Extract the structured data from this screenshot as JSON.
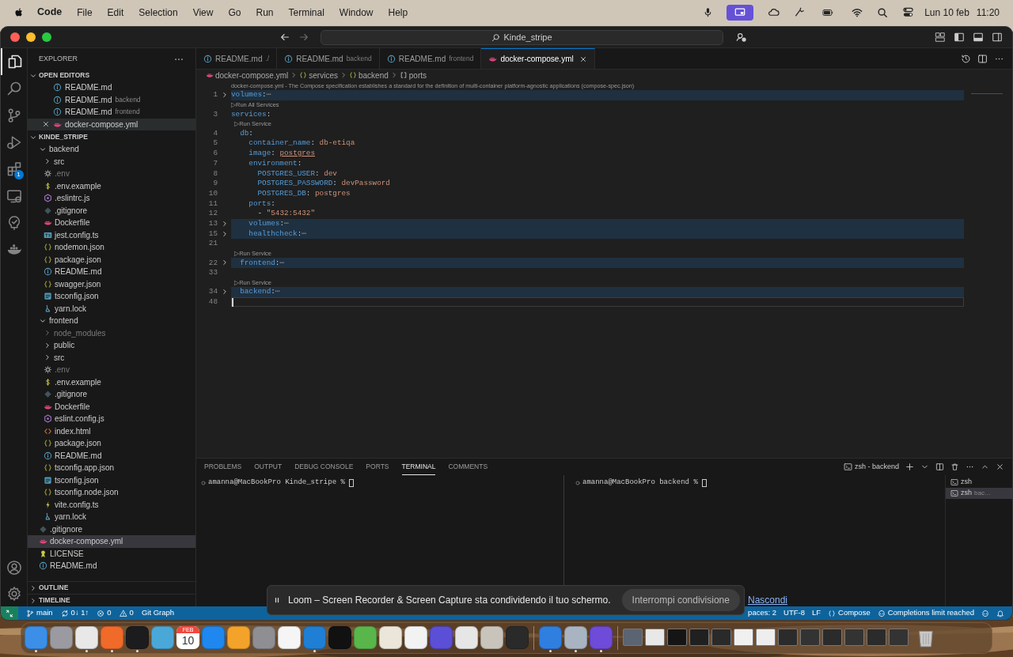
{
  "menu_bar": {
    "app": "Code",
    "menus": [
      "File",
      "Edit",
      "Selection",
      "View",
      "Go",
      "Run",
      "Terminal",
      "Window",
      "Help"
    ],
    "date": "Lun 10 feb",
    "time": "11:20"
  },
  "title_bar": {
    "search": "Kinde_stripe"
  },
  "activity_bar": {
    "items": [
      {
        "selected": true
      },
      {
        "selected": false
      },
      {
        "selected": false
      },
      {
        "selected": false
      },
      {
        "selected": false,
        "badge": "1"
      },
      {
        "selected": false
      },
      {
        "selected": false
      },
      {
        "selected": false
      }
    ]
  },
  "sidebar": {
    "title": "EXPLORER",
    "open_editors": {
      "label": "OPEN EDITORS",
      "expanded": true,
      "items": [
        {
          "name": "README.md",
          "kind": "info",
          "selected": false
        },
        {
          "name": "README.md",
          "hint": "backend",
          "kind": "info",
          "selected": false
        },
        {
          "name": "README.md",
          "hint": "frontend",
          "kind": "info",
          "selected": false
        },
        {
          "name": "docker-compose.yml",
          "kind": "docker",
          "selected": true
        }
      ]
    },
    "project": {
      "label": "KINDE_STRIPE",
      "expanded": true,
      "children": [
        {
          "name": "backend",
          "kind": "folder",
          "expanded": true,
          "dimmed": false,
          "selected": false,
          "children": [
            {
              "name": "src",
              "kind": "folder",
              "expanded": false,
              "dimmed": false,
              "selected": false
            },
            {
              "name": ".env",
              "kind": "gear",
              "dimmed": true,
              "selected": false
            },
            {
              "name": ".env.example",
              "kind": "dollar",
              "dimmed": false,
              "selected": false
            },
            {
              "name": ".eslintrc.js",
              "kind": "eslint",
              "dimmed": false,
              "selected": false
            },
            {
              "name": ".gitignore",
              "kind": "git",
              "dimmed": false,
              "selected": false
            },
            {
              "name": "Dockerfile",
              "kind": "docker",
              "dimmed": false,
              "selected": false
            },
            {
              "name": "jest.config.ts",
              "kind": "ts",
              "dimmed": false,
              "selected": false
            },
            {
              "name": "nodemon.json",
              "kind": "braces",
              "dimmed": false,
              "selected": false
            },
            {
              "name": "package.json",
              "kind": "braces",
              "dimmed": false,
              "selected": false
            },
            {
              "name": "README.md",
              "kind": "info",
              "dimmed": false,
              "selected": false
            },
            {
              "name": "swagger.json",
              "kind": "braces",
              "dimmed": false,
              "selected": false
            },
            {
              "name": "tsconfig.json",
              "kind": "tsconfig",
              "dimmed": false,
              "selected": false
            },
            {
              "name": "yarn.lock",
              "kind": "yarn",
              "dimmed": false,
              "selected": false
            }
          ]
        },
        {
          "name": "frontend",
          "kind": "folder",
          "expanded": true,
          "dimmed": false,
          "selected": false,
          "children": [
            {
              "name": "node_modules",
              "kind": "folder",
              "expanded": false,
              "dimmed": true,
              "selected": false
            },
            {
              "name": "public",
              "kind": "folder",
              "expanded": false,
              "dimmed": false,
              "selected": false
            },
            {
              "name": "src",
              "kind": "folder",
              "expanded": false,
              "dimmed": false,
              "selected": false
            },
            {
              "name": ".env",
              "kind": "gear",
              "dimmed": true,
              "selected": false
            },
            {
              "name": ".env.example",
              "kind": "dollar",
              "dimmed": false,
              "selected": false
            },
            {
              "name": ".gitignore",
              "kind": "git",
              "dimmed": false,
              "selected": false
            },
            {
              "name": "Dockerfile",
              "kind": "docker",
              "dimmed": false,
              "selected": false
            },
            {
              "name": "eslint.config.js",
              "kind": "eslint",
              "dimmed": false,
              "selected": false
            },
            {
              "name": "index.html",
              "kind": "html",
              "dimmed": false,
              "selected": false
            },
            {
              "name": "package.json",
              "kind": "braces",
              "dimmed": false,
              "selected": false
            },
            {
              "name": "README.md",
              "kind": "info",
              "dimmed": false,
              "selected": false
            },
            {
              "name": "tsconfig.app.json",
              "kind": "braces",
              "dimmed": false,
              "selected": false
            },
            {
              "name": "tsconfig.json",
              "kind": "tsconfig",
              "dimmed": false,
              "selected": false
            },
            {
              "name": "tsconfig.node.json",
              "kind": "braces",
              "dimmed": false,
              "selected": false
            },
            {
              "name": "vite.config.ts",
              "kind": "vite",
              "dimmed": false,
              "selected": false
            },
            {
              "name": "yarn.lock",
              "kind": "yarn",
              "dimmed": false,
              "selected": false
            }
          ]
        },
        {
          "name": ".gitignore",
          "kind": "git",
          "dimmed": false,
          "selected": false
        },
        {
          "name": "docker-compose.yml",
          "kind": "docker",
          "dimmed": false,
          "selected": true
        },
        {
          "name": "LICENSE",
          "kind": "license",
          "dimmed": false,
          "selected": false
        },
        {
          "name": "README.md",
          "kind": "info",
          "dimmed": false,
          "selected": false
        }
      ]
    },
    "outline": {
      "label": "OUTLINE",
      "expanded": false
    },
    "timeline": {
      "label": "TIMELINE",
      "expanded": false
    }
  },
  "tabs": [
    {
      "label": "README.md",
      "hint": "./",
      "kind": "info",
      "selected": false
    },
    {
      "label": "README.md",
      "hint": "backend",
      "kind": "info",
      "selected": false
    },
    {
      "label": "README.md",
      "hint": "frontend",
      "kind": "info",
      "selected": false
    },
    {
      "label": "docker-compose.yml",
      "kind": "docker",
      "selected": true
    }
  ],
  "breadcrumbs": [
    {
      "kind": "docker",
      "label": "docker-compose.yml"
    },
    {
      "kind": "braces",
      "label": "services"
    },
    {
      "kind": "braces",
      "label": "backend"
    },
    {
      "kind": "brackets",
      "label": "ports"
    }
  ],
  "schema_hint": "docker-compose.yml - The Compose specification establishes a standard for the definition of multi-container platform-agnostic applications (compose-spec.json)",
  "code": [
    {
      "kind": "line",
      "number": "1",
      "folded": true,
      "cursor": false,
      "tokens": [
        {
          "text": "volumes",
          "kind": "key"
        },
        {
          "text": ":",
          "kind": "punct"
        },
        {
          "text": "⋯",
          "kind": "fold"
        }
      ]
    },
    {
      "kind": "codelens",
      "text": "▷Run All Services"
    },
    {
      "kind": "line",
      "number": "3",
      "folded": false,
      "cursor": false,
      "tokens": [
        {
          "text": "services",
          "kind": "key"
        },
        {
          "text": ":",
          "kind": "punct"
        }
      ]
    },
    {
      "kind": "codelens",
      "text": "  ▷Run Service"
    },
    {
      "kind": "line",
      "number": "4",
      "folded": false,
      "cursor": false,
      "tokens": [
        {
          "text": "  db",
          "kind": "key"
        },
        {
          "text": ":",
          "kind": "punct"
        }
      ]
    },
    {
      "kind": "line",
      "number": "5",
      "folded": false,
      "cursor": false,
      "tokens": [
        {
          "text": "    container_name",
          "kind": "key"
        },
        {
          "text": ":",
          "kind": "punct"
        },
        {
          "text": " db-etiqa",
          "kind": "value"
        }
      ]
    },
    {
      "kind": "line",
      "number": "6",
      "folded": false,
      "cursor": false,
      "tokens": [
        {
          "text": "    image",
          "kind": "key"
        },
        {
          "text": ": ",
          "kind": "punct"
        },
        {
          "text": "postgres",
          "kind": "value",
          "underlined": true
        }
      ]
    },
    {
      "kind": "line",
      "number": "7",
      "folded": false,
      "cursor": false,
      "tokens": [
        {
          "text": "    environment",
          "kind": "key"
        },
        {
          "text": ":",
          "kind": "punct"
        }
      ]
    },
    {
      "kind": "line",
      "number": "8",
      "folded": false,
      "cursor": false,
      "tokens": [
        {
          "text": "      POSTGRES_USER",
          "kind": "key"
        },
        {
          "text": ":",
          "kind": "punct"
        },
        {
          "text": " dev",
          "kind": "value"
        }
      ]
    },
    {
      "kind": "line",
      "number": "9",
      "folded": false,
      "cursor": false,
      "tokens": [
        {
          "text": "      POSTGRES_PASSWORD",
          "kind": "key"
        },
        {
          "text": ":",
          "kind": "punct"
        },
        {
          "text": " devPassword",
          "kind": "value"
        }
      ]
    },
    {
      "kind": "line",
      "number": "10",
      "folded": false,
      "cursor": false,
      "tokens": [
        {
          "text": "      POSTGRES_DB",
          "kind": "key"
        },
        {
          "text": ":",
          "kind": "punct"
        },
        {
          "text": " postgres",
          "kind": "value"
        }
      ]
    },
    {
      "kind": "line",
      "number": "11",
      "folded": false,
      "cursor": false,
      "tokens": [
        {
          "text": "    ports",
          "kind": "key"
        },
        {
          "text": ":",
          "kind": "punct"
        }
      ]
    },
    {
      "kind": "line",
      "number": "12",
      "folded": false,
      "cursor": false,
      "tokens": [
        {
          "text": "      - ",
          "kind": "punct"
        },
        {
          "text": "\"5432:5432\"",
          "kind": "value"
        }
      ]
    },
    {
      "kind": "line",
      "number": "13",
      "folded": true,
      "cursor": false,
      "tokens": [
        {
          "text": "    volumes",
          "kind": "key"
        },
        {
          "text": ":",
          "kind": "punct"
        },
        {
          "text": "⋯",
          "kind": "fold"
        }
      ]
    },
    {
      "kind": "line",
      "number": "15",
      "folded": true,
      "cursor": false,
      "tokens": [
        {
          "text": "    healthcheck",
          "kind": "key"
        },
        {
          "text": ":",
          "kind": "punct"
        },
        {
          "text": "⋯",
          "kind": "fold"
        }
      ]
    },
    {
      "kind": "line",
      "number": "21",
      "folded": false,
      "cursor": false
    },
    {
      "kind": "codelens",
      "text": "  ▷Run Service"
    },
    {
      "kind": "line",
      "number": "22",
      "folded": true,
      "cursor": false,
      "tokens": [
        {
          "text": "  frontend",
          "kind": "key"
        },
        {
          "text": ":",
          "kind": "punct"
        },
        {
          "text": "⋯",
          "kind": "fold"
        }
      ]
    },
    {
      "kind": "line",
      "number": "33",
      "folded": false,
      "cursor": false
    },
    {
      "kind": "codelens",
      "text": "  ▷Run Service"
    },
    {
      "kind": "line",
      "number": "34",
      "folded": true,
      "cursor": false,
      "tokens": [
        {
          "text": "  backend",
          "kind": "key"
        },
        {
          "text": ":",
          "kind": "punct"
        },
        {
          "text": "⋯",
          "kind": "fold"
        }
      ]
    },
    {
      "kind": "line",
      "number": "48",
      "folded": false,
      "cursor": true
    }
  ],
  "panel": {
    "tabs": [
      {
        "label": "PROBLEMS",
        "selected": false
      },
      {
        "label": "OUTPUT",
        "selected": false
      },
      {
        "label": "DEBUG CONSOLE",
        "selected": false
      },
      {
        "label": "PORTS",
        "selected": false
      },
      {
        "label": "TERMINAL",
        "selected": true
      },
      {
        "label": "COMMENTS",
        "selected": false
      }
    ],
    "terminal_title": "zsh - backend",
    "panes": [
      {
        "prompt": "amanna@MacBookPro Kinde_stripe %"
      },
      {
        "prompt": "amanna@MacBookPro backend %"
      }
    ],
    "terminals": [
      {
        "label": "zsh",
        "selected": false
      },
      {
        "label": "zsh",
        "hint": "bac…",
        "selected": true
      }
    ]
  },
  "share_bar": {
    "message": "Loom – Screen Recorder & Screen Capture sta condividendo il tuo schermo.",
    "stop": "Interrompi condivisione",
    "hide": "Nascondi"
  },
  "status_bar": {
    "left": [
      {
        "kind": "remote"
      },
      {
        "kind": "branch",
        "text": "main"
      },
      {
        "kind": "sync",
        "text": "0↓ 1↑"
      },
      {
        "kind": "errors",
        "text": "0"
      },
      {
        "kind": "warnings",
        "text": "0"
      },
      {
        "kind": "text",
        "text": "Git Graph"
      }
    ],
    "right": [
      {
        "kind": "text",
        "text": "paces: 2"
      },
      {
        "kind": "text",
        "text": "UTF-8"
      },
      {
        "kind": "text",
        "text": "LF"
      },
      {
        "kind": "braces",
        "text": "Compose"
      },
      {
        "kind": "copilot",
        "text": "Completions limit reached"
      },
      {
        "kind": "copilot"
      },
      {
        "kind": "bell"
      }
    ]
  },
  "dock": [
    {
      "kind": "app",
      "color": "#3b8fe8",
      "running": true
    },
    {
      "kind": "app",
      "color": "#9a9aa0",
      "running": false
    },
    {
      "kind": "app",
      "color": "#e8e8e8",
      "running": true
    },
    {
      "kind": "app",
      "color": "#f06a2a",
      "running": true
    },
    {
      "kind": "app",
      "color": "#1c1c1e",
      "running": true
    },
    {
      "kind": "app",
      "color": "#4aa8d8",
      "running": false
    },
    {
      "kind": "calendar",
      "month": "FEB",
      "day": "10",
      "running": false
    },
    {
      "kind": "app",
      "color": "#1e88f0",
      "running": false
    },
    {
      "kind": "app",
      "color": "#f4a32a",
      "running": false
    },
    {
      "kind": "app",
      "color": "#8e8e93",
      "running": false
    },
    {
      "kind": "app",
      "color": "#f5f5f5",
      "running": false
    },
    {
      "kind": "app",
      "color": "#1f7fd4",
      "running": true
    },
    {
      "kind": "app",
      "color": "#111111",
      "running": false
    },
    {
      "kind": "app",
      "color": "#59b64a",
      "running": false
    },
    {
      "kind": "app",
      "color": "#ece6da",
      "running": false
    },
    {
      "kind": "app",
      "color": "#f2f2f2",
      "running": false
    },
    {
      "kind": "app",
      "color": "#5a4fd6",
      "running": false
    },
    {
      "kind": "app",
      "color": "#e6e6e6",
      "running": false
    },
    {
      "kind": "app",
      "color": "#c9c4bb",
      "running": false
    },
    {
      "kind": "app",
      "color": "#2a2a2a",
      "running": false
    },
    {
      "kind": "separator"
    },
    {
      "kind": "app",
      "color": "#2f7fe0",
      "running": true
    },
    {
      "kind": "app",
      "color": "#a9b4c2",
      "running": true
    },
    {
      "kind": "app",
      "color": "#6e4bd8",
      "running": true
    },
    {
      "kind": "separator"
    },
    {
      "kind": "window",
      "color": "#5a6472"
    },
    {
      "kind": "window",
      "color": "#e8e8e8"
    },
    {
      "kind": "window",
      "color": "#151515"
    },
    {
      "kind": "window",
      "color": "#202020"
    },
    {
      "kind": "window",
      "color": "#2a2a2a"
    },
    {
      "kind": "window",
      "color": "#f0f0f0"
    },
    {
      "kind": "window",
      "color": "#eeeeee"
    },
    {
      "kind": "window",
      "color": "#2b2b2b"
    },
    {
      "kind": "window",
      "color": "#333333"
    },
    {
      "kind": "window",
      "color": "#2b2b2b"
    },
    {
      "kind": "window",
      "color": "#333333"
    },
    {
      "kind": "window",
      "color": "#2b2b2b"
    },
    {
      "kind": "window",
      "color": "#333333"
    },
    {
      "kind": "trash"
    }
  ]
}
